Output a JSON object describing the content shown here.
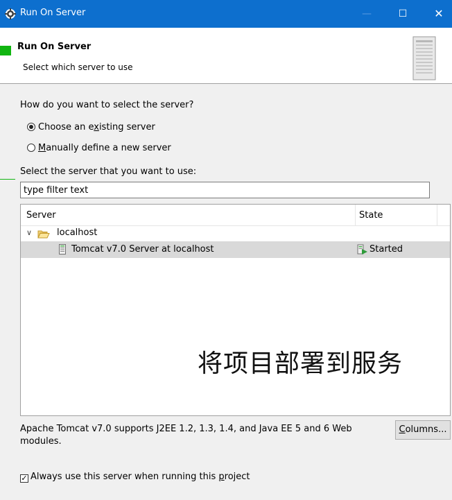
{
  "window": {
    "title": "Run On Server",
    "icon": "gear-icon",
    "controls": {
      "minimize": "—",
      "maximize": "☐",
      "close": "✕"
    }
  },
  "banner": {
    "title": "Run On Server",
    "subtitle": "Select which server to use",
    "accent_color": "#11b511"
  },
  "selection": {
    "question": "How do you want to select the server?",
    "options": [
      {
        "pre": "Choose an e",
        "mnemonic": "x",
        "post": "isting server",
        "selected": true
      },
      {
        "pre": "",
        "mnemonic": "M",
        "post": "anually define a new server",
        "selected": false
      }
    ]
  },
  "server_list": {
    "label": "Select the server that you want to use:",
    "filter": {
      "value": "type filter text",
      "placeholder": "type filter text"
    },
    "columns": [
      "Server",
      "State"
    ],
    "tree": {
      "host": {
        "label": "localhost",
        "expanded": true
      },
      "servers": [
        {
          "name": "Tomcat v7.0 Server at localhost",
          "state": "Started",
          "selected": true
        }
      ]
    }
  },
  "overlay_text": "将项目部署到服务",
  "description": "Apache Tomcat v7.0 supports J2EE 1.2, 1.3, 1.4, and Java EE 5 and 6 Web modules.",
  "columns_button": {
    "mnemonic": "C",
    "rest": "olumns..."
  },
  "always_use": {
    "pre": "Always use this server when running this ",
    "mnemonic": "p",
    "post": "roject",
    "checked": true
  },
  "colors": {
    "titlebar": "#0d6fce",
    "selection_row": "#d9d9d9"
  }
}
